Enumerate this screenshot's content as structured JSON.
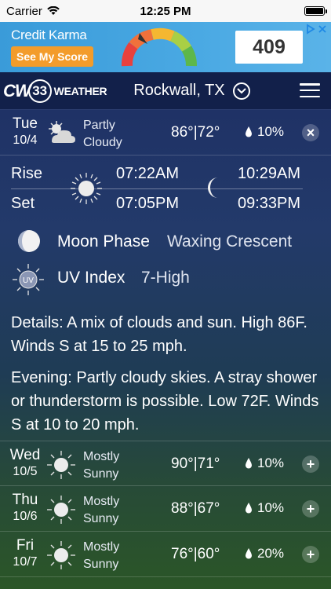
{
  "status_bar": {
    "carrier": "Carrier",
    "time": "12:25 PM"
  },
  "ad": {
    "brand": "Credit Karma",
    "button": "See My Score",
    "score": "409"
  },
  "header": {
    "logo_cw": "CW",
    "logo_number": "33",
    "logo_weather": "WEATHER",
    "location": "Rockwall, TX"
  },
  "today": {
    "day": "Tue",
    "date": "10/4",
    "condition_line1": "Partly",
    "condition_line2": "Cloudy",
    "temps": "86°|72°",
    "precip": "10%",
    "toggle": "×"
  },
  "sun_moon": {
    "rise_label": "Rise",
    "set_label": "Set",
    "sunrise": "07:22AM",
    "sunset": "07:05PM",
    "moonrise": "10:29AM",
    "moonset": "09:33PM"
  },
  "moon_phase": {
    "label": "Moon Phase",
    "value": "Waxing Crescent"
  },
  "uv": {
    "label": "UV Index",
    "value": "7-High",
    "icon_text": "UV"
  },
  "details": "Details: A mix of clouds and sun. High 86F. Winds S at 15 to 25 mph.",
  "evening": "Evening: Partly cloudy skies. A stray shower or thunderstorm is possible. Low 72F. Winds S at 10 to 20 mph.",
  "forecast": [
    {
      "day": "Wed",
      "date": "10/5",
      "cond1": "Mostly",
      "cond2": "Sunny",
      "temps": "90°|71°",
      "precip": "10%",
      "toggle": "+"
    },
    {
      "day": "Thu",
      "date": "10/6",
      "cond1": "Mostly",
      "cond2": "Sunny",
      "temps": "88°|67°",
      "precip": "10%",
      "toggle": "+"
    },
    {
      "day": "Fri",
      "date": "10/7",
      "cond1": "Mostly",
      "cond2": "Sunny",
      "temps": "76°|60°",
      "precip": "20%",
      "toggle": "+"
    }
  ],
  "colors": {
    "header_bg": "#12204a",
    "ad_blue": "#3a9bd9",
    "ad_orange": "#f39c2b"
  }
}
